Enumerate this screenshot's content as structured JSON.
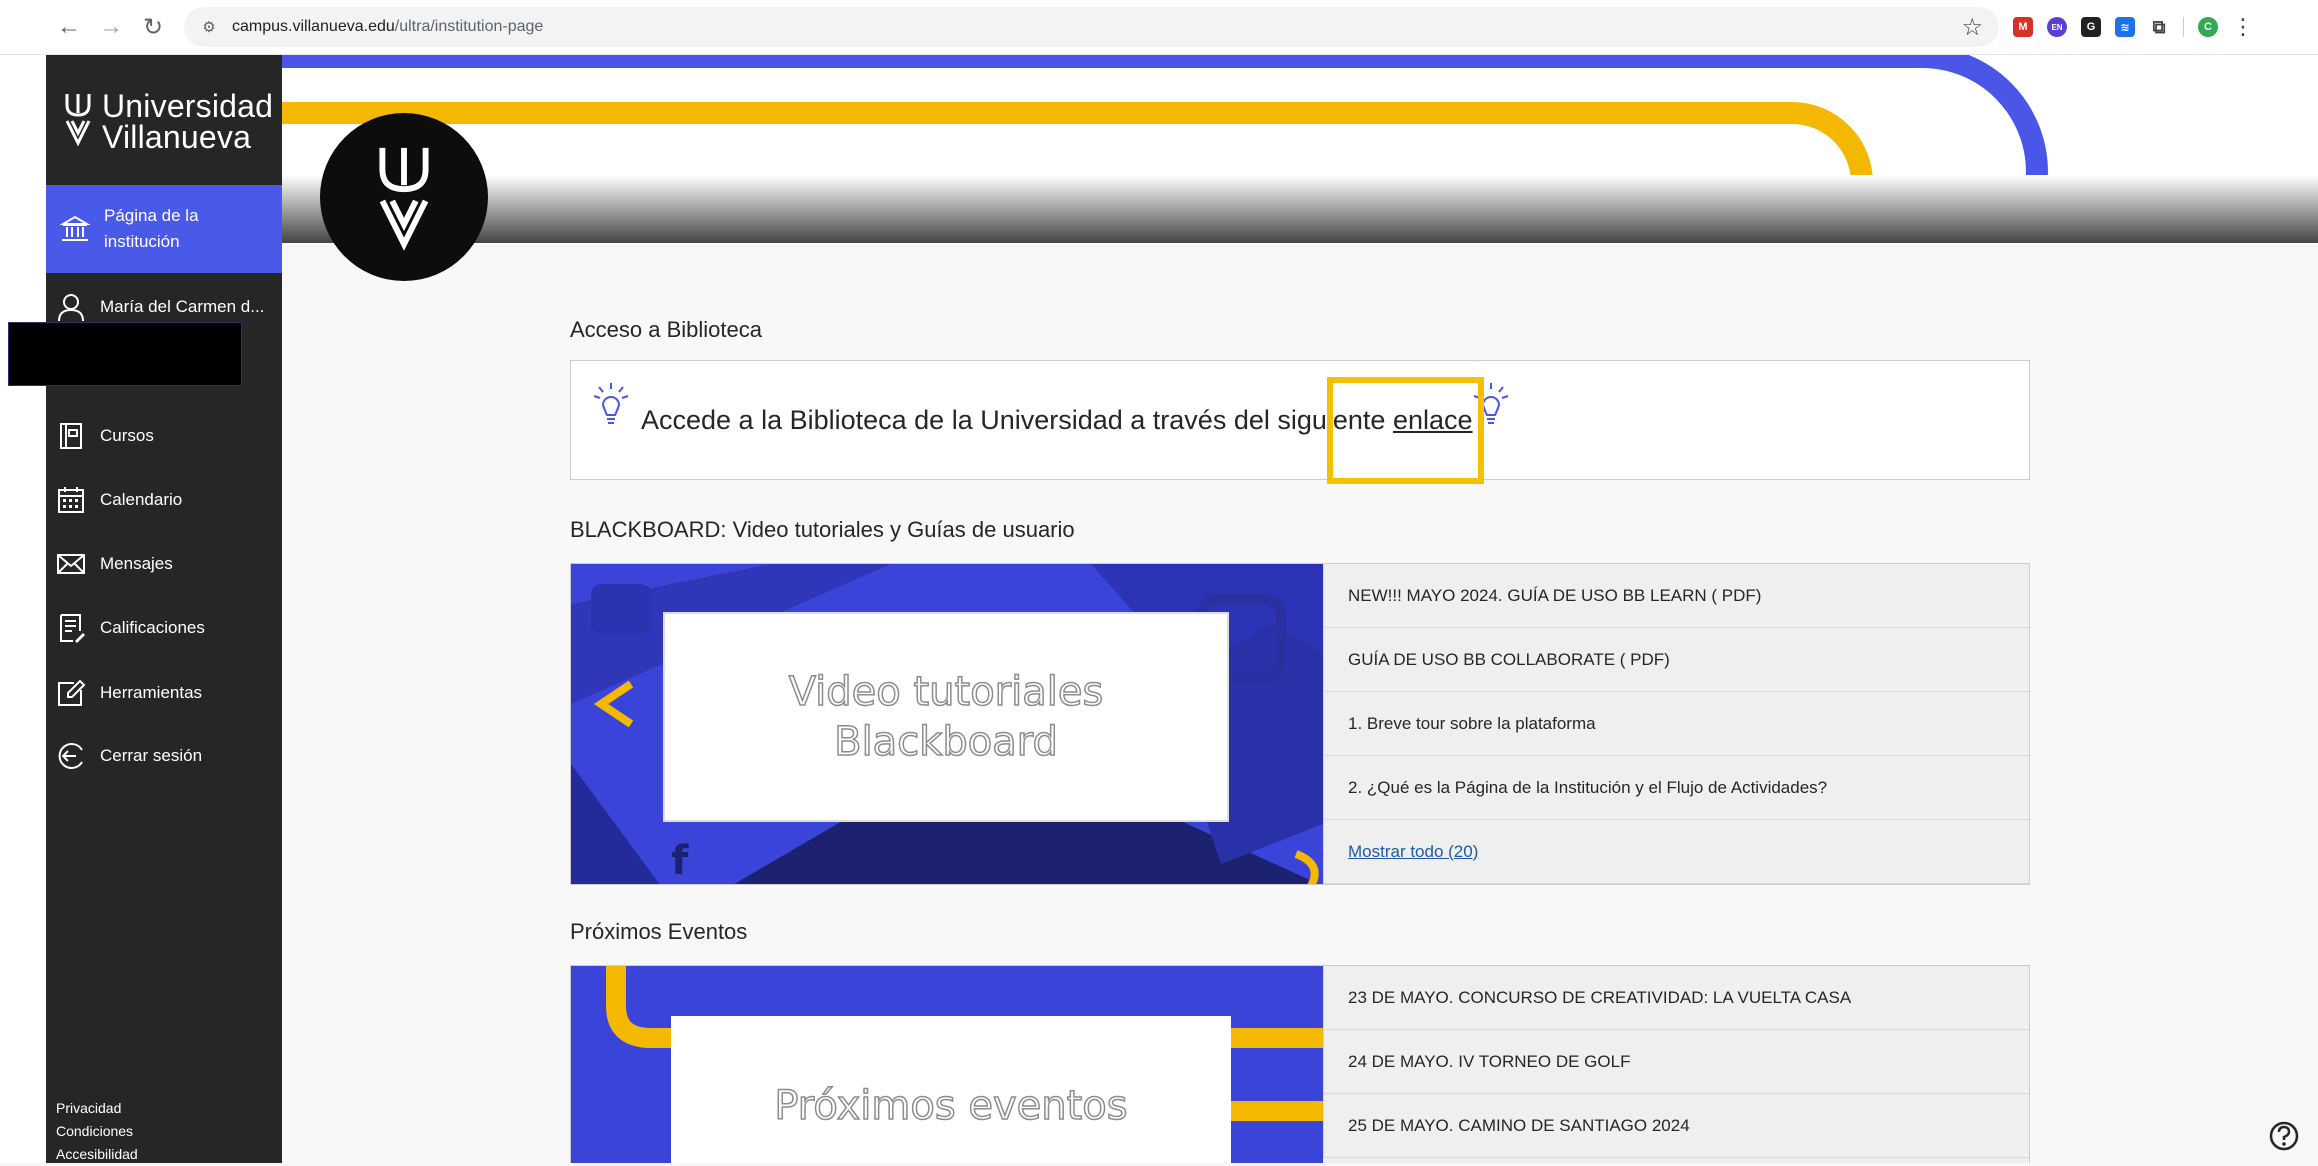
{
  "browser": {
    "url_host": "campus.villanueva.edu",
    "url_path": "/ultra/institution-page",
    "extensions": [
      {
        "name": "ext-red-icon",
        "color": "#d93025",
        "label": "M"
      },
      {
        "name": "ext-purple-icon",
        "color": "#5b3fd3",
        "label": "EN"
      },
      {
        "name": "ext-black-icon",
        "color": "#202124",
        "label": "G"
      },
      {
        "name": "ext-blue-icon",
        "color": "#1a73e8",
        "label": "≋"
      },
      {
        "name": "ext-puzzle-icon",
        "color": "#ffffff",
        "label": ""
      },
      {
        "name": "profile-avatar",
        "color": "#34a853",
        "label": "C"
      }
    ]
  },
  "sidebar": {
    "logo_line1": "Universidad",
    "logo_line2": "Villanueva",
    "active_item": {
      "line1": "Página de la",
      "line2": "institución"
    },
    "user_name": "María del Carmen d...",
    "items": [
      {
        "label": "Cursos",
        "icon": "courses-icon"
      },
      {
        "label": "Calendario",
        "icon": "calendar-icon"
      },
      {
        "label": "Mensajes",
        "icon": "envelope-icon"
      },
      {
        "label": "Calificaciones",
        "icon": "grades-icon"
      },
      {
        "label": "Herramientas",
        "icon": "tools-icon"
      },
      {
        "label": "Cerrar sesión",
        "icon": "logout-icon"
      }
    ],
    "footer": [
      "Privacidad",
      "Condiciones",
      "Accesibilidad"
    ]
  },
  "main": {
    "library": {
      "title": "Acceso a Biblioteca",
      "text_before": "Accede a la Biblioteca de la Universidad a través del siguiente ",
      "link": "enlace"
    },
    "blackboard": {
      "title": "BLACKBOARD: Video tutoriales y Guías de usuario",
      "image_line1": "Video tutoriales",
      "image_line2": "Blackboard",
      "rows": [
        "NEW!!! MAYO 2024. GUÍA DE USO BB LEARN ( PDF)",
        "GUÍA DE USO BB COLLABORATE ( PDF)",
        "1. Breve tour sobre la plataforma",
        "2. ¿Qué es la Página de la Institución y el Flujo de Actividades?"
      ],
      "show_all": "Mostrar todo (20)"
    },
    "events": {
      "title": "Próximos Eventos",
      "image_text": "Próximos eventos",
      "rows": [
        "23 DE MAYO. CONCURSO DE CREATIVIDAD: LA VUELTA CASA",
        "24 DE MAYO. IV TORNEO DE GOLF",
        "25 DE MAYO. CAMINO DE SANTIAGO 2024"
      ]
    }
  },
  "colors": {
    "accent": "#4a5ae8",
    "sidebar": "#262626",
    "gold": "#f5b800",
    "highlight": "#f5c000"
  }
}
